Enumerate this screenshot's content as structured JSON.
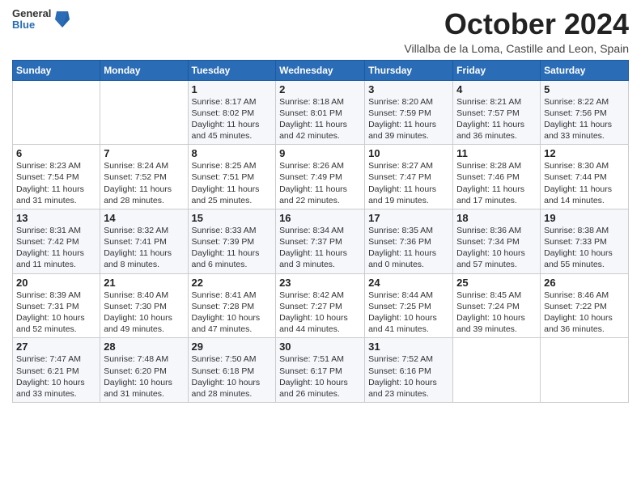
{
  "header": {
    "logo_line1": "General",
    "logo_line2": "Blue",
    "month_title": "October 2024",
    "subtitle": "Villalba de la Loma, Castille and Leon, Spain"
  },
  "weekdays": [
    "Sunday",
    "Monday",
    "Tuesday",
    "Wednesday",
    "Thursday",
    "Friday",
    "Saturday"
  ],
  "weeks": [
    [
      {
        "day": "",
        "info": ""
      },
      {
        "day": "",
        "info": ""
      },
      {
        "day": "1",
        "info": "Sunrise: 8:17 AM\nSunset: 8:02 PM\nDaylight: 11 hours and 45 minutes."
      },
      {
        "day": "2",
        "info": "Sunrise: 8:18 AM\nSunset: 8:01 PM\nDaylight: 11 hours and 42 minutes."
      },
      {
        "day": "3",
        "info": "Sunrise: 8:20 AM\nSunset: 7:59 PM\nDaylight: 11 hours and 39 minutes."
      },
      {
        "day": "4",
        "info": "Sunrise: 8:21 AM\nSunset: 7:57 PM\nDaylight: 11 hours and 36 minutes."
      },
      {
        "day": "5",
        "info": "Sunrise: 8:22 AM\nSunset: 7:56 PM\nDaylight: 11 hours and 33 minutes."
      }
    ],
    [
      {
        "day": "6",
        "info": "Sunrise: 8:23 AM\nSunset: 7:54 PM\nDaylight: 11 hours and 31 minutes."
      },
      {
        "day": "7",
        "info": "Sunrise: 8:24 AM\nSunset: 7:52 PM\nDaylight: 11 hours and 28 minutes."
      },
      {
        "day": "8",
        "info": "Sunrise: 8:25 AM\nSunset: 7:51 PM\nDaylight: 11 hours and 25 minutes."
      },
      {
        "day": "9",
        "info": "Sunrise: 8:26 AM\nSunset: 7:49 PM\nDaylight: 11 hours and 22 minutes."
      },
      {
        "day": "10",
        "info": "Sunrise: 8:27 AM\nSunset: 7:47 PM\nDaylight: 11 hours and 19 minutes."
      },
      {
        "day": "11",
        "info": "Sunrise: 8:28 AM\nSunset: 7:46 PM\nDaylight: 11 hours and 17 minutes."
      },
      {
        "day": "12",
        "info": "Sunrise: 8:30 AM\nSunset: 7:44 PM\nDaylight: 11 hours and 14 minutes."
      }
    ],
    [
      {
        "day": "13",
        "info": "Sunrise: 8:31 AM\nSunset: 7:42 PM\nDaylight: 11 hours and 11 minutes."
      },
      {
        "day": "14",
        "info": "Sunrise: 8:32 AM\nSunset: 7:41 PM\nDaylight: 11 hours and 8 minutes."
      },
      {
        "day": "15",
        "info": "Sunrise: 8:33 AM\nSunset: 7:39 PM\nDaylight: 11 hours and 6 minutes."
      },
      {
        "day": "16",
        "info": "Sunrise: 8:34 AM\nSunset: 7:37 PM\nDaylight: 11 hours and 3 minutes."
      },
      {
        "day": "17",
        "info": "Sunrise: 8:35 AM\nSunset: 7:36 PM\nDaylight: 11 hours and 0 minutes."
      },
      {
        "day": "18",
        "info": "Sunrise: 8:36 AM\nSunset: 7:34 PM\nDaylight: 10 hours and 57 minutes."
      },
      {
        "day": "19",
        "info": "Sunrise: 8:38 AM\nSunset: 7:33 PM\nDaylight: 10 hours and 55 minutes."
      }
    ],
    [
      {
        "day": "20",
        "info": "Sunrise: 8:39 AM\nSunset: 7:31 PM\nDaylight: 10 hours and 52 minutes."
      },
      {
        "day": "21",
        "info": "Sunrise: 8:40 AM\nSunset: 7:30 PM\nDaylight: 10 hours and 49 minutes."
      },
      {
        "day": "22",
        "info": "Sunrise: 8:41 AM\nSunset: 7:28 PM\nDaylight: 10 hours and 47 minutes."
      },
      {
        "day": "23",
        "info": "Sunrise: 8:42 AM\nSunset: 7:27 PM\nDaylight: 10 hours and 44 minutes."
      },
      {
        "day": "24",
        "info": "Sunrise: 8:44 AM\nSunset: 7:25 PM\nDaylight: 10 hours and 41 minutes."
      },
      {
        "day": "25",
        "info": "Sunrise: 8:45 AM\nSunset: 7:24 PM\nDaylight: 10 hours and 39 minutes."
      },
      {
        "day": "26",
        "info": "Sunrise: 8:46 AM\nSunset: 7:22 PM\nDaylight: 10 hours and 36 minutes."
      }
    ],
    [
      {
        "day": "27",
        "info": "Sunrise: 7:47 AM\nSunset: 6:21 PM\nDaylight: 10 hours and 33 minutes."
      },
      {
        "day": "28",
        "info": "Sunrise: 7:48 AM\nSunset: 6:20 PM\nDaylight: 10 hours and 31 minutes."
      },
      {
        "day": "29",
        "info": "Sunrise: 7:50 AM\nSunset: 6:18 PM\nDaylight: 10 hours and 28 minutes."
      },
      {
        "day": "30",
        "info": "Sunrise: 7:51 AM\nSunset: 6:17 PM\nDaylight: 10 hours and 26 minutes."
      },
      {
        "day": "31",
        "info": "Sunrise: 7:52 AM\nSunset: 6:16 PM\nDaylight: 10 hours and 23 minutes."
      },
      {
        "day": "",
        "info": ""
      },
      {
        "day": "",
        "info": ""
      }
    ]
  ]
}
